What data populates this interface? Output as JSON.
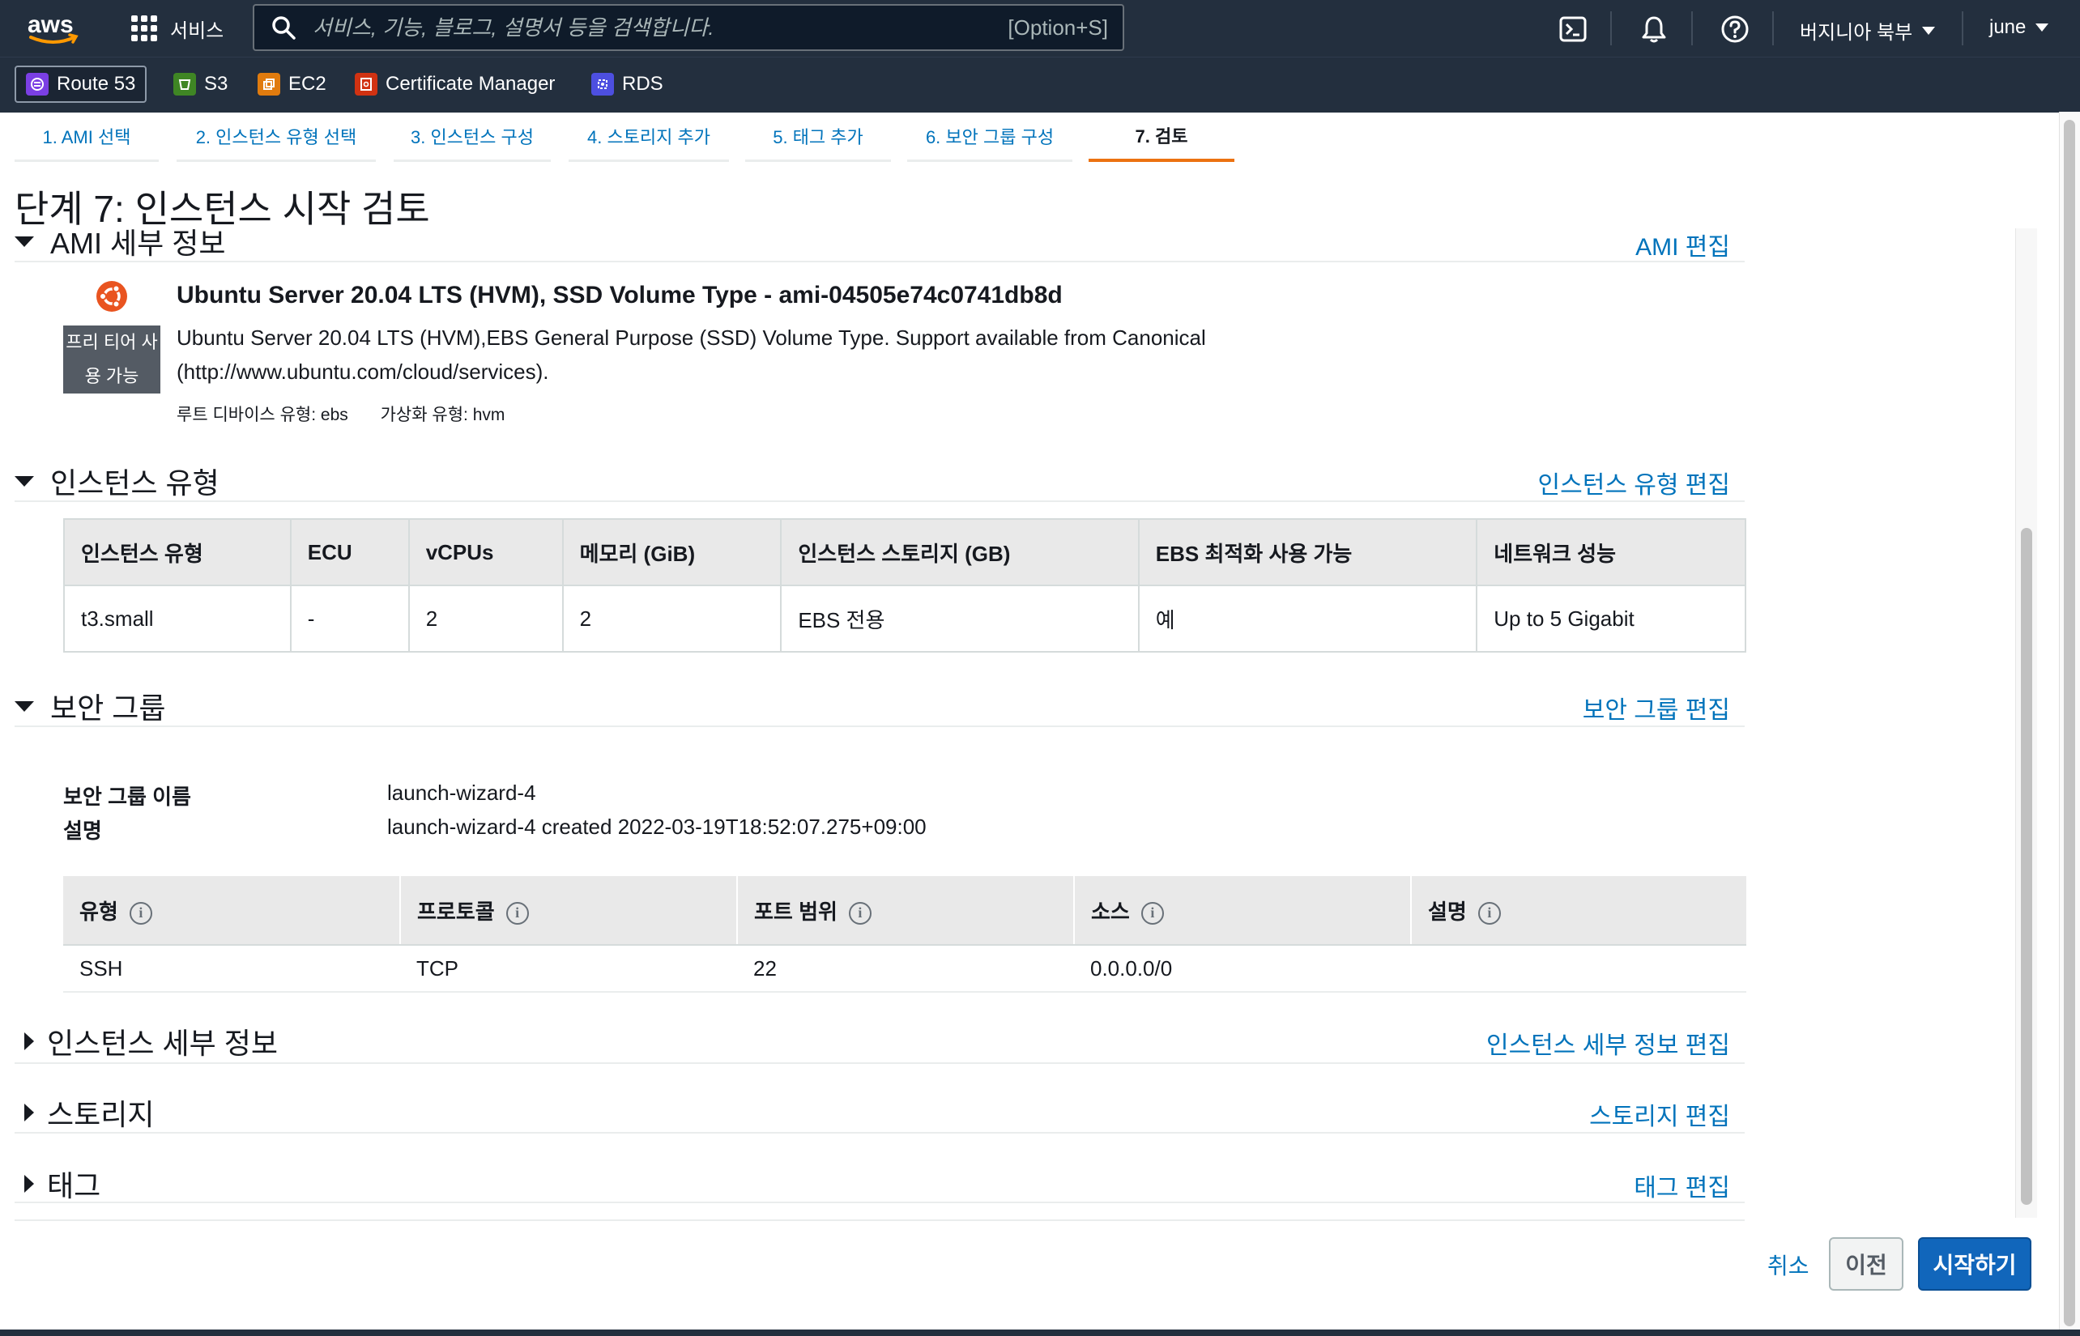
{
  "topnav": {
    "logo_text": "aws",
    "services_label": "서비스",
    "search_placeholder": "서비스, 기능, 블로그, 설명서 등을 검색합니다.",
    "search_shortcut": "[Option+S]",
    "region_label": "버지니아 북부",
    "user_label": "june"
  },
  "favorites": [
    {
      "label": "Route 53",
      "color": "#7b3fe4"
    },
    {
      "label": "S3",
      "color": "#3f8624"
    },
    {
      "label": "EC2",
      "color": "#e07b0e"
    },
    {
      "label": "Certificate Manager",
      "color": "#d13212"
    },
    {
      "label": "RDS",
      "color": "#4d4fe0"
    }
  ],
  "tabs": [
    {
      "label": "1. AMI 선택"
    },
    {
      "label": "2. 인스턴스 유형 선택"
    },
    {
      "label": "3. 인스턴스 구성"
    },
    {
      "label": "4. 스토리지 추가"
    },
    {
      "label": "5. 태그 추가"
    },
    {
      "label": "6. 보안 그룹 구성"
    },
    {
      "label": "7. 검토",
      "active": true
    }
  ],
  "page_title": "단계 7: 인스턴스 시작 검토",
  "ami": {
    "section_title": "AMI 세부 정보",
    "edit_label": "AMI 편집",
    "free_tier_badge": "프리 티어 사용 가능",
    "title": "Ubuntu Server 20.04 LTS (HVM), SSD Volume Type - ami-04505e74c0741db8d",
    "description": "Ubuntu Server 20.04 LTS (HVM),EBS General Purpose (SSD) Volume Type. Support available from Canonical (http://www.ubuntu.com/cloud/services).",
    "root_device": "루트 디바이스 유형: ebs",
    "virtualization": "가상화 유형: hvm"
  },
  "instance_type": {
    "section_title": "인스턴스 유형",
    "edit_label": "인스턴스 유형 편집",
    "columns": [
      "인스턴스 유형",
      "ECU",
      "vCPUs",
      "메모리 (GiB)",
      "인스턴스 스토리지 (GB)",
      "EBS 최적화 사용 가능",
      "네트워크 성능"
    ],
    "rows": [
      [
        "t3.small",
        "-",
        "2",
        "2",
        "EBS 전용",
        "예",
        "Up to 5 Gigabit"
      ]
    ]
  },
  "security_group": {
    "section_title": "보안 그룹",
    "edit_label": "보안 그룹 편집",
    "name_label": "보안 그룹 이름",
    "name_value": "launch-wizard-4",
    "desc_label": "설명",
    "desc_value": "launch-wizard-4 created 2022-03-19T18:52:07.275+09:00",
    "columns": [
      "유형",
      "프로토콜",
      "포트 범위",
      "소스",
      "설명"
    ],
    "rows": [
      [
        "SSH",
        "TCP",
        "22",
        "0.0.0.0/0",
        ""
      ]
    ]
  },
  "instance_details": {
    "section_title": "인스턴스 세부 정보",
    "edit_label": "인스턴스 세부 정보 편집"
  },
  "storage": {
    "section_title": "스토리지",
    "edit_label": "스토리지 편집"
  },
  "tags": {
    "section_title": "태그",
    "edit_label": "태그 편집"
  },
  "footer": {
    "cancel_label": "취소",
    "prev_label": "이전",
    "launch_label": "시작하기"
  }
}
